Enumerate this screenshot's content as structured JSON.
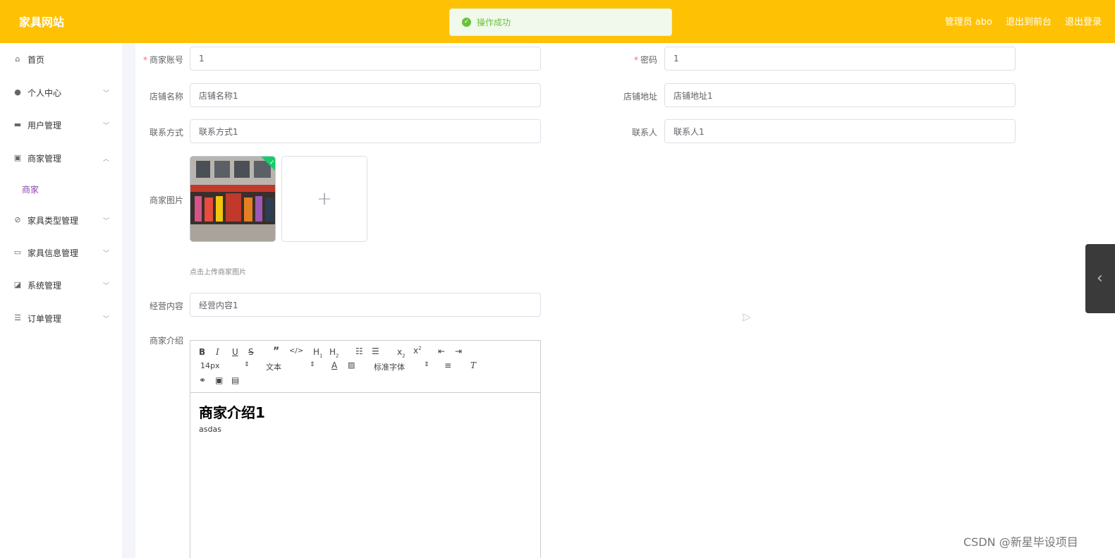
{
  "header": {
    "brand": "家具网站",
    "admin_label": "管理员 abo",
    "to_front": "退出到前台",
    "logout": "退出登录"
  },
  "toast": {
    "message": "操作成功"
  },
  "sidebar": {
    "items": [
      {
        "label": "首页",
        "icon": "home-icon"
      },
      {
        "label": "个人中心",
        "icon": "user-icon"
      },
      {
        "label": "用户管理",
        "icon": "users-icon"
      },
      {
        "label": "商家管理",
        "icon": "clipboard-icon"
      },
      {
        "label": "家具类型管理",
        "icon": "tag-icon"
      },
      {
        "label": "家具信息管理",
        "icon": "card-icon"
      },
      {
        "label": "系统管理",
        "icon": "chart-icon"
      },
      {
        "label": "订单管理",
        "icon": "list-icon"
      }
    ],
    "sub_item": "商家"
  },
  "form": {
    "account": {
      "label": "商家账号",
      "value": "1"
    },
    "password": {
      "label": "密码",
      "value": "1"
    },
    "shop_name": {
      "label": "店铺名称",
      "value": "店铺名称1"
    },
    "shop_address": {
      "label": "店铺地址",
      "value": "店铺地址1"
    },
    "contact": {
      "label": "联系方式",
      "value": "联系方式1"
    },
    "contact_person": {
      "label": "联系人",
      "value": "联系人1"
    },
    "image": {
      "label": "商家图片",
      "tip": "点击上传商家图片"
    },
    "business": {
      "label": "经营内容",
      "value": "经营内容1"
    },
    "intro": {
      "label": "商家介绍"
    }
  },
  "editor": {
    "font_size": "14px",
    "text_style": "文本",
    "font_family": "标准字体",
    "heading": "商家介绍1",
    "body": "asdas"
  },
  "watermark": "CSDN @新星毕设项目"
}
